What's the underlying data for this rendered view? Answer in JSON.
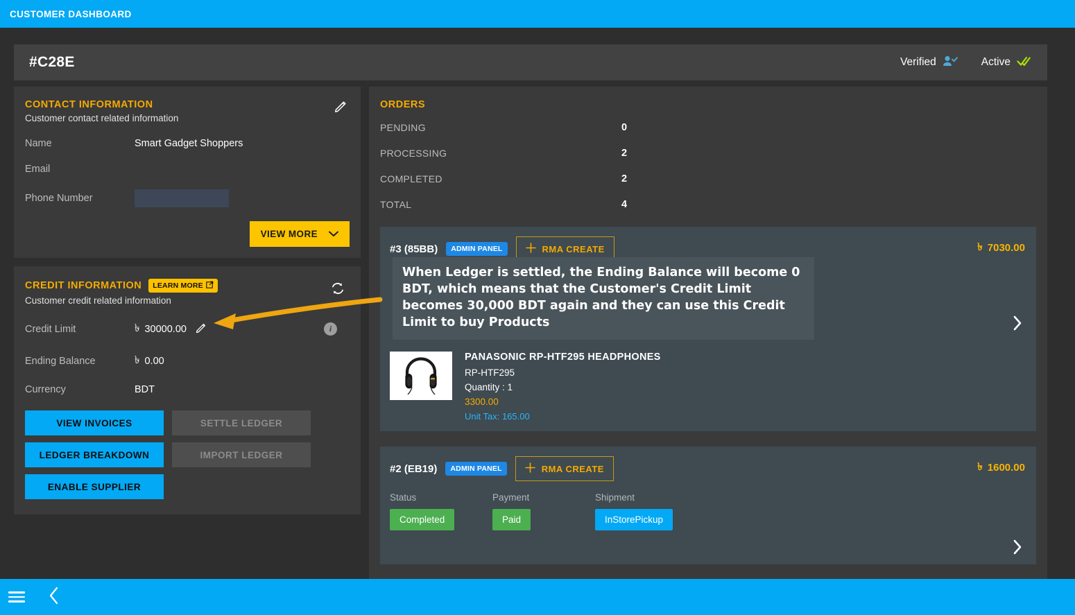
{
  "topbar": {
    "title": "CUSTOMER DASHBOARD"
  },
  "header": {
    "customer_id": "#C28E",
    "verified_label": "Verified",
    "verified_icon": "user-check-icon",
    "active_label": "Active",
    "active_icon": "double-check-icon"
  },
  "contact": {
    "title": "CONTACT INFORMATION",
    "subtitle": "Customer contact related information",
    "edit_icon": "pencil-icon",
    "rows": [
      {
        "label": "Name",
        "value": "Smart Gadget Shoppers"
      },
      {
        "label": "Email",
        "value": ""
      },
      {
        "label": "Phone Number",
        "value": ""
      }
    ],
    "view_more_label": "VIEW MORE",
    "view_more_icon": "chevron-down-icon"
  },
  "credit": {
    "title": "CREDIT INFORMATION",
    "learn_more_label": "LEARN MORE",
    "learn_more_icon": "external-link-icon",
    "subtitle": "Customer credit related information",
    "refresh_icon": "sync-icon",
    "info_icon": "info-icon",
    "credit_limit_label": "Credit Limit",
    "credit_limit_currency": "৳",
    "credit_limit_value": "30000.00",
    "credit_limit_edit_icon": "pencil-icon",
    "ending_balance_label": "Ending Balance",
    "ending_balance_currency": "৳",
    "ending_balance_value": "0.00",
    "currency_label": "Currency",
    "currency_value": "BDT",
    "buttons": [
      {
        "label": "VIEW INVOICES",
        "state": "enabled"
      },
      {
        "label": "SETTLE LEDGER",
        "state": "disabled"
      },
      {
        "label": "LEDGER BREAKDOWN",
        "state": "enabled"
      },
      {
        "label": "IMPORT LEDGER",
        "state": "disabled"
      },
      {
        "label": "ENABLE SUPPLIER",
        "state": "enabled"
      }
    ]
  },
  "orders": {
    "title": "ORDERS",
    "summary": [
      {
        "label": "PENDING",
        "value": "0"
      },
      {
        "label": "PROCESSING",
        "value": "2"
      },
      {
        "label": "COMPLETED",
        "value": "2"
      },
      {
        "label": "TOTAL",
        "value": "4"
      }
    ],
    "card1": {
      "id": "#3 (85BB)",
      "admin_badge": "ADMIN PANEL",
      "rma_label": "RMA CREATE",
      "rma_icon": "plus-icon",
      "currency": "৳",
      "amount": "7030.00",
      "chevron_icon": "chevron-right-icon",
      "product": {
        "image_icon": "headphones-product-image",
        "name": "PANASONIC RP-HTF295 HEADPHONES",
        "sku": "RP-HTF295",
        "quantity": "Quantity : 1",
        "price": "3300.00",
        "unit_tax": "Unit Tax: 165.00"
      }
    },
    "card2": {
      "id": "#2 (EB19)",
      "admin_badge": "ADMIN PANEL",
      "rma_label": "RMA CREATE",
      "rma_icon": "plus-icon",
      "currency": "৳",
      "amount": "1600.00",
      "chevron_icon": "chevron-right-icon",
      "stats": [
        {
          "label": "Status",
          "value": "Completed",
          "color": "#4caf50"
        },
        {
          "label": "Payment",
          "value": "Paid",
          "color": "#4caf50"
        },
        {
          "label": "Shipment",
          "value": "InStorePickup",
          "color": "#03a9f4"
        }
      ]
    }
  },
  "annotation": {
    "text": "When Ledger is settled, the Ending Balance will become 0 BDT, which means that the Customer's Credit Limit becomes 30,000 BDT again and they can use this Credit Limit to buy Products",
    "arrow_color": "#efa611"
  },
  "bottombar": {
    "menu_icon": "hamburger-menu-icon",
    "back_icon": "chevron-left-icon"
  }
}
